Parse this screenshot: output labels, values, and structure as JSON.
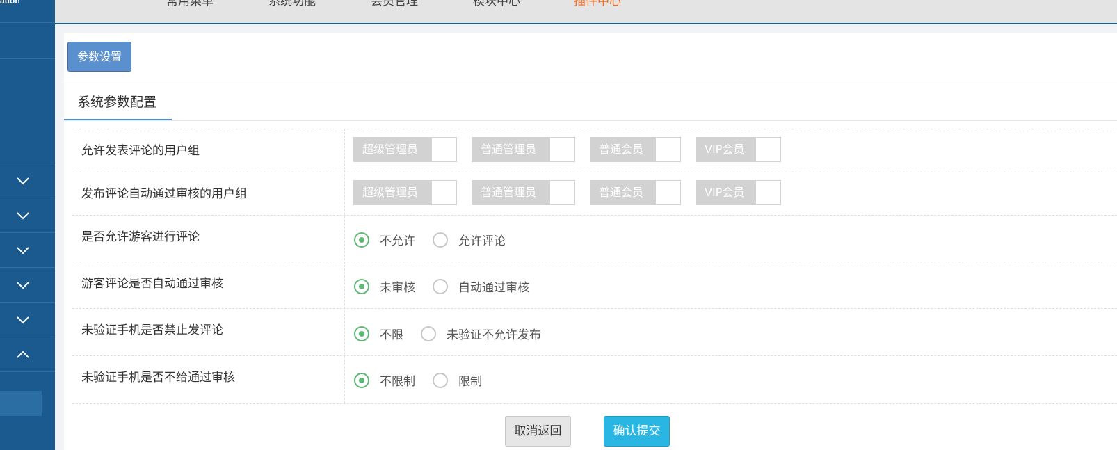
{
  "sidebar": {
    "brand": "ation"
  },
  "topnav": [
    {
      "label": "常用菜单",
      "active": false
    },
    {
      "label": "系统功能",
      "active": false
    },
    {
      "label": "会员管理",
      "active": false
    },
    {
      "label": "模块中心",
      "active": false
    },
    {
      "label": "插件中心",
      "active": true
    }
  ],
  "toolbar": {
    "param_button": "参数设置"
  },
  "tab": {
    "title": "系统参数配置"
  },
  "group_rows": [
    {
      "label": "允许发表评论的用户组",
      "options": [
        "超级管理员",
        "普通管理员",
        "普通会员",
        "VIP会员"
      ]
    },
    {
      "label": "发布评论自动通过审核的用户组",
      "options": [
        "超级管理员",
        "普通管理员",
        "普通会员",
        "VIP会员"
      ]
    }
  ],
  "radio_rows": [
    {
      "label": "是否允许游客进行评论",
      "options": [
        "不允许",
        "允许评论"
      ],
      "selected": 0
    },
    {
      "label": "游客评论是否自动通过审核",
      "options": [
        "未审核",
        "自动通过审核"
      ],
      "selected": 0
    },
    {
      "label": "未验证手机是否禁止发评论",
      "options": [
        "不限",
        "未验证不允许发布"
      ],
      "selected": 0
    },
    {
      "label": "未验证手机是否不给通过审核",
      "options": [
        "不限制",
        "限制"
      ],
      "selected": 0
    }
  ],
  "actions": {
    "cancel": "取消返回",
    "submit": "确认提交"
  },
  "colors": {
    "sidebar": "#1a5a8e",
    "accent_nav": "#f06a20",
    "radio_on": "#5fb878",
    "submit": "#29b6e3"
  }
}
